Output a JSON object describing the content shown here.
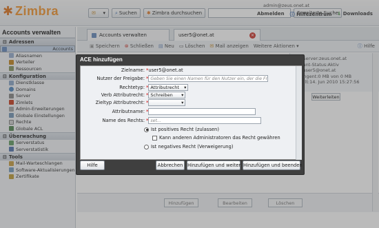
{
  "app": {
    "logo_text": "Zimbra",
    "brand_color": "#f39a3a"
  },
  "search": {
    "search_label": "Suchen",
    "zimbra_search_label": "Zimbra durchsuchen",
    "advanced_label": "Erweiterte Suche"
  },
  "user": {
    "email": "admin@zeus.onet.at",
    "logout_label": "Abmelden",
    "help_label": "Hilfezentrum",
    "downloads_label": "Downloads"
  },
  "sidebar": {
    "title": "Accounts verwalten",
    "sections": [
      {
        "label": "Adressen",
        "items": [
          "Accounts",
          "Aliasnamen",
          "Verteiler",
          "Ressourcen"
        ]
      },
      {
        "label": "Konfiguration",
        "items": [
          "Dienstklasse",
          "Domains",
          "Server",
          "Zimlets",
          "Admin-Erweiterungen",
          "Globale Einstellungen",
          "Rechte",
          "Globale ACL"
        ]
      },
      {
        "label": "Überwachung",
        "items": [
          "Serverstatus",
          "Serverstatistik"
        ]
      },
      {
        "label": "Tools",
        "items": [
          "Mail-Warteschlangen",
          "Software-Aktualisierungen",
          "Zertifikate"
        ]
      }
    ]
  },
  "tabs": [
    {
      "label": "Accounts verwalten"
    },
    {
      "label": "user5@onet.at"
    }
  ],
  "toolbar": {
    "save": "Speichern",
    "close": "Schließen",
    "new": "Neu",
    "delete": "Löschen",
    "view_mail": "Mail anzeigen",
    "more": "Weitere Aktionen",
    "help": "Hilfe"
  },
  "account_info": {
    "line1": "Mail-Server:zeus.onet.at",
    "line2": "Account-Status:Aktiv",
    "line3": "Mail:user5@onet.at",
    "line4": "Kontingent:0 MB von 0 MB",
    "line5": "Erstellt:14. Jun 2010 15:27:56"
  },
  "forward_button": "Weiterleiten",
  "bottom_buttons": {
    "add": "Hinzufügen",
    "edit": "Bearbeiten",
    "remove": "Löschen"
  },
  "dialog": {
    "title": "ACE hinzufügen",
    "target_name_label": "Zielname:",
    "target_name_value": "user5@onet.at",
    "grantee_label": "Nutzer der Freigabe:",
    "grantee_placeholder": "Geben Sie einen Namen für den Nutzer ein, der die Freigabe erhält",
    "right_type_label": "Rechtetyp:",
    "right_type_value": "Attributrecht",
    "verb_label": "Verb Attributrecht:",
    "verb_value": "Schreiben",
    "target_type_label": "Zieltyp Attributrecht:",
    "target_type_value": "",
    "attr_name_label": "Attributname:",
    "right_name_label": "Name des Rechts:",
    "right_name_placeholder": "set...",
    "positive_label": "Ist positives Recht (zulassen)",
    "can_grant_label": "Kann anderen Administratoren das Recht gewähren",
    "negative_label": "Ist negatives Recht (Verweigerung)",
    "help": "Hilfe",
    "cancel": "Abbrechen",
    "add_more": "Hinzufügen und weiter",
    "add_finish": "Hinzufügen und beenden"
  }
}
